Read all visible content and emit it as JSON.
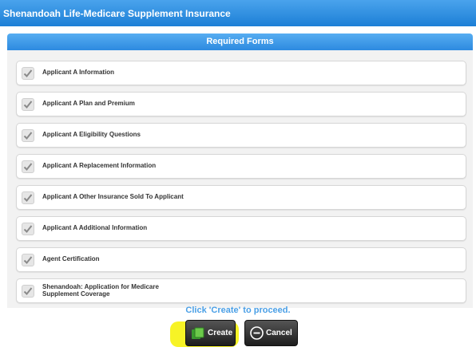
{
  "window": {
    "title": "Shenandoah Life-Medicare Supplement Insurance"
  },
  "section": {
    "title": "Required Forms"
  },
  "forms": [
    {
      "label": "Applicant A Information",
      "checked": true
    },
    {
      "label": "Applicant A Plan and Premium",
      "checked": true
    },
    {
      "label": "Applicant A Eligibility Questions",
      "checked": true
    },
    {
      "label": "Applicant A Replacement Information",
      "checked": true
    },
    {
      "label": "Applicant A Other Insurance Sold To Applicant",
      "checked": true
    },
    {
      "label": "Applicant A Additional Information",
      "checked": true
    },
    {
      "label": "Agent Certification",
      "checked": true
    },
    {
      "label_line1": "Shenandoah: Application for Medicare",
      "label_line2": "Supplement Coverage",
      "checked": true
    }
  ],
  "prompt": "Click 'Create' to proceed.",
  "actions": {
    "create_label": "Create",
    "cancel_label": "Cancel"
  },
  "colors": {
    "title_bar": "#1c7fd6",
    "prompt_text": "#4a9fe6",
    "highlight": "#f7f21a"
  }
}
